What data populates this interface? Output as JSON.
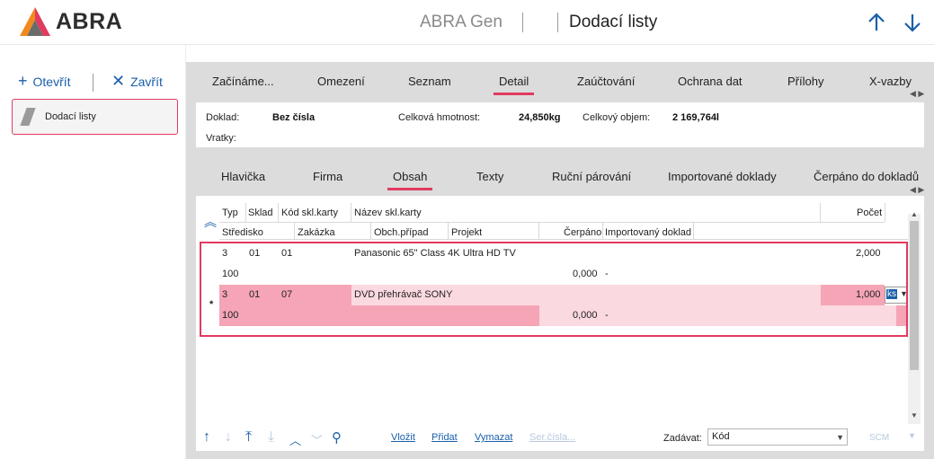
{
  "header": {
    "logo_text": "ABRA",
    "app_name": "ABRA Gen",
    "page_title": "Dodací listy",
    "accent_color": "#e23a5f",
    "link_color": "#1a5faa"
  },
  "left": {
    "open_label": "Otevřít",
    "close_label": "Zavřít",
    "card_label": "Dodací listy"
  },
  "tabs_main": [
    {
      "label": "Začínáme..."
    },
    {
      "label": "Omezení"
    },
    {
      "label": "Seznam"
    },
    {
      "label": "Detail",
      "active": true
    },
    {
      "label": "Zaúčtování"
    },
    {
      "label": "Ochrana dat"
    },
    {
      "label": "Přílohy"
    },
    {
      "label": "X-vazby"
    }
  ],
  "info": {
    "doklad_label": "Doklad:",
    "doklad_value": "Bez čísla",
    "hmotnost_label": "Celková hmotnost:",
    "hmotnost_value": "24,850kg",
    "objem_label": "Celkový objem:",
    "objem_value": "2 169,764l",
    "vratky_label": "Vratky:"
  },
  "tabs_sub": [
    {
      "label": "Hlavička"
    },
    {
      "label": "Firma"
    },
    {
      "label": "Obsah",
      "active": true
    },
    {
      "label": "Texty"
    },
    {
      "label": "Ruční párování"
    },
    {
      "label": "Importované doklady"
    },
    {
      "label": "Čerpáno do dokladů"
    }
  ],
  "grid": {
    "headers_row1": {
      "typ": "Typ",
      "sklad": "Sklad",
      "kod": "Kód skl.karty",
      "nazev": "Název skl.karty",
      "pocet": "Počet"
    },
    "headers_row2": {
      "stredisko": "Středisko",
      "zakazka": "Zakázka",
      "obch": "Obch.případ",
      "projekt": "Projekt",
      "cerpano": "Čerpáno",
      "importovany": "Importovaný doklad"
    },
    "rows": [
      {
        "typ": "3",
        "sklad": "01",
        "kod": "01",
        "nazev": "Panasonic 65\" Class 4K Ultra HD TV",
        "pocet": "2,000",
        "stredisko": "100",
        "cerpano": "0,000",
        "importovany": "-"
      },
      {
        "typ": "3",
        "sklad": "01",
        "kod": "07",
        "nazev": "DVD přehrávač SONY",
        "pocet": "1,000",
        "unit": "ks",
        "stredisko": "100",
        "cerpano": "0,000",
        "importovany": "-",
        "marker": "*"
      }
    ]
  },
  "bottom": {
    "vlozit": "Vložit",
    "pridat": "Přidat",
    "vymazat": "Vymazat",
    "sercisla": "Ser.čísla...",
    "zadavat_label": "Zadávat:",
    "zadavat_value": "Kód",
    "scm": "SCM"
  }
}
